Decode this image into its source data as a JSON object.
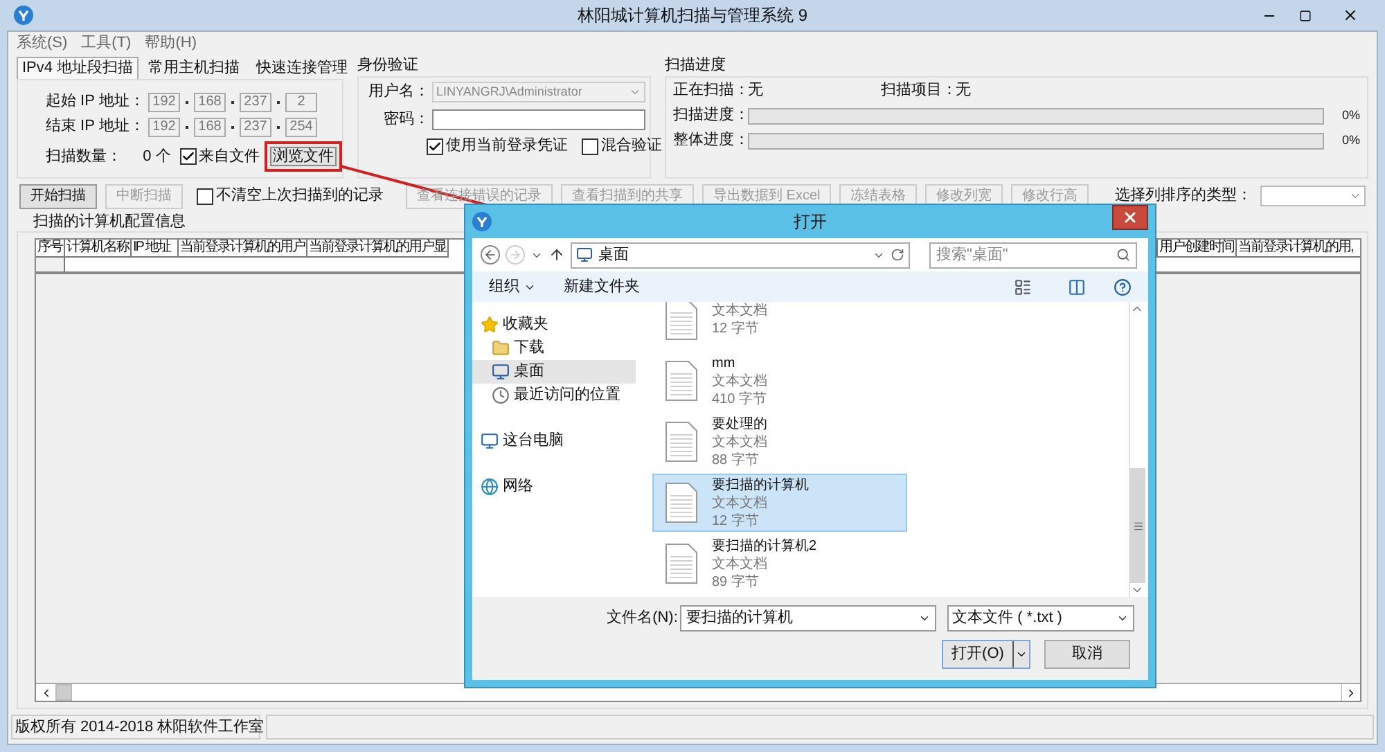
{
  "window": {
    "title": "林阳城计算机扫描与管理系统 9"
  },
  "menu": [
    "系统(S)",
    "工具(T)",
    "帮助(H)"
  ],
  "scan_tabs": [
    {
      "label": "IPv4 地址段扫描",
      "selected": true
    },
    {
      "label": "常用主机扫描",
      "selected": false
    },
    {
      "label": "快速连接管理",
      "selected": false
    }
  ],
  "ip_range": {
    "rows": [
      {
        "label": "起始 IP 地址：",
        "octets": [
          "192",
          "168",
          "237",
          "2"
        ]
      },
      {
        "label": "结束 IP 地址：",
        "octets": [
          "192",
          "168",
          "237",
          "254"
        ]
      }
    ],
    "count_label": "扫描数量：",
    "count": "0 个",
    "from_file": {
      "label": "来自文件",
      "checked": true
    },
    "browse_button": {
      "label": "浏览文件",
      "highlighted": true
    }
  },
  "auth": {
    "title": "身份验证",
    "user_label": "用户名：",
    "user": "LINYANGRJ\\Administrator",
    "user_disabled": true,
    "password_label": "密码：",
    "options": [
      {
        "label": "使用当前登录凭证",
        "checked": true
      },
      {
        "label": "混合验证",
        "checked": false
      }
    ]
  },
  "progress": {
    "title": "扫描进度",
    "scanning_label": "正在扫描：",
    "scanning": "无",
    "item_label": "扫描项目：",
    "item": "无",
    "bars": [
      {
        "label": "扫描进度：",
        "level": 0,
        "reading": "0%"
      },
      {
        "label": "整体进度：",
        "level": 0,
        "reading": "0%"
      }
    ]
  },
  "toolbar": [
    {
      "kind": "button",
      "label": "开始扫描",
      "disabled": false
    },
    {
      "kind": "button",
      "label": "中断扫描",
      "disabled": true
    },
    {
      "kind": "checkbox",
      "label": "不清空上次扫描到的记录",
      "checked": false
    },
    {
      "kind": "button",
      "label": "查看连接错误的记录",
      "disabled": true
    },
    {
      "kind": "button",
      "label": "查看扫描到的共享",
      "disabled": true
    },
    {
      "kind": "button",
      "label": "导出数据到 Excel",
      "disabled": true
    },
    {
      "kind": "button",
      "label": "冻结表格",
      "disabled": true
    },
    {
      "kind": "button",
      "label": "修改列宽",
      "disabled": true
    },
    {
      "kind": "button",
      "label": "修改行高",
      "disabled": true
    },
    {
      "kind": "label",
      "label": "选择列排序的类型："
    },
    {
      "kind": "dropdown"
    }
  ],
  "table": {
    "title": "扫描的计算机配置信息",
    "columns_left": [
      "序号",
      "计算机名称",
      "IP 地址",
      "当前登录计算机的用户",
      "当前登录计算机的用户显"
    ],
    "columns_right": [
      "用户创建时间",
      "当前登录计算机的用,"
    ]
  },
  "status_bar": [
    "版权所有 2014-2018 林阳软件工作室"
  ],
  "dialog": {
    "title": "打开",
    "location": "桌面",
    "search_placeholder": "搜索\"桌面\"",
    "commands": [
      "组织",
      "新建文件夹"
    ],
    "nav": [
      {
        "kind": "favorites",
        "label": "收藏夹",
        "selected": false
      },
      {
        "kind": "downloads",
        "label": "下载",
        "selected": false
      },
      {
        "kind": "desktop",
        "label": "桌面",
        "selected": true
      },
      {
        "kind": "recent",
        "label": "最近访问的位置",
        "selected": false
      },
      {
        "kind": "computer",
        "label": "这台电脑",
        "selected": false
      },
      {
        "kind": "network",
        "label": "网络",
        "selected": false
      }
    ],
    "files": [
      {
        "type": "文本文档",
        "size": "12 字节",
        "selected": false
      },
      {
        "name": "mm",
        "type": "文本文档",
        "size": "410 字节",
        "selected": false
      },
      {
        "name": "要处理的",
        "type": "文本文档",
        "size": "88 字节",
        "selected": false
      },
      {
        "name": "要扫描的计算机",
        "type": "文本文档",
        "size": "12 字节",
        "selected": true
      },
      {
        "name": "要扫描的计算机2",
        "type": "文本文档",
        "size": "89 字节",
        "selected": false
      }
    ],
    "filename_label": "文件名(N):",
    "filename": "要扫描的计算机",
    "filter": "文本文件 ( *.txt )",
    "open_button": "打开(O)",
    "cancel_button": "取消"
  }
}
